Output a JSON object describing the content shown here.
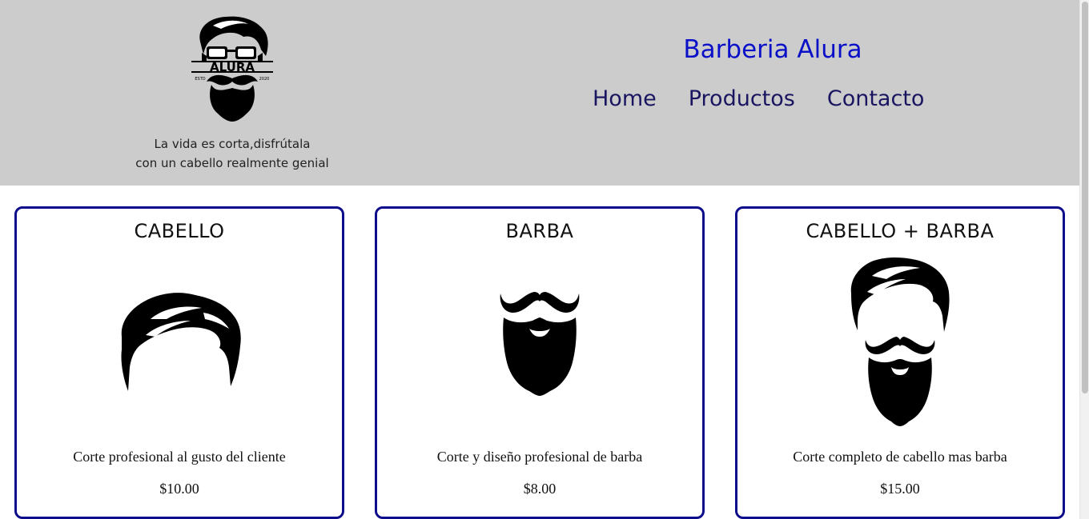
{
  "header": {
    "logo_text": "ALURA",
    "logo_estd": "ESTD",
    "logo_year": "2020",
    "tagline_line1": "La vida es corta,disfrútala",
    "tagline_line2": "con un cabello realmente genial",
    "brand": "Barberia Alura",
    "nav": [
      "Home",
      "Productos",
      "Contacto"
    ]
  },
  "colors": {
    "header_bg": "#cccccc",
    "brand": "#0a10c8",
    "nav": "#1a1560",
    "card_border": "#0d0d8c"
  },
  "products": [
    {
      "title": "CABELLO",
      "icon": "hair-icon",
      "description": "Corte profesional al gusto del cliente",
      "price": "$10.00"
    },
    {
      "title": "BARBA",
      "icon": "beard-icon",
      "description": "Corte y diseño profesional de barba",
      "price": "$8.00"
    },
    {
      "title": "CABELLO + BARBA",
      "icon": "hair-and-beard-icon",
      "description": "Corte completo de cabello mas barba",
      "price": "$15.00"
    }
  ]
}
